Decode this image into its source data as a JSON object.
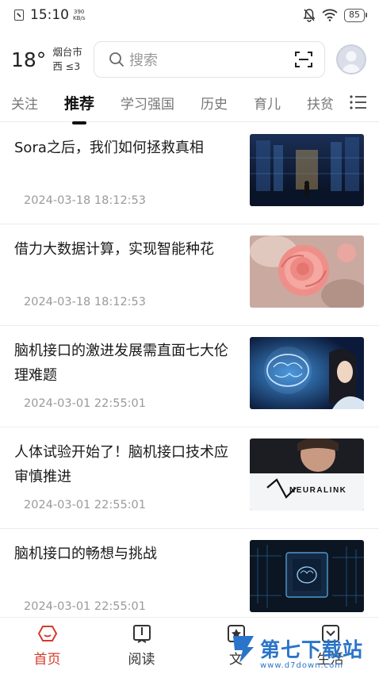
{
  "status_bar": {
    "time": "15:10",
    "speed_value": "390",
    "speed_unit": "KB/s",
    "battery": "85"
  },
  "header": {
    "temperature": "18°",
    "city": "烟台市",
    "wind": "西 ≤3",
    "search_placeholder": "搜索"
  },
  "tabs": [
    "关注",
    "推荐",
    "学习强国",
    "历史",
    "育儿",
    "扶贫"
  ],
  "active_tab": "推荐",
  "articles": [
    {
      "title": "Sora之后，我们如何拯救真相",
      "date": "2024-03-18 18:12:53",
      "image": "futuristic-corridor"
    },
    {
      "title": "借力大数据计算，实现智能种花",
      "date": "2024-03-18 18:12:53",
      "image": "pink-rose"
    },
    {
      "title": "脑机接口的激进发展需直面七大伦理难题",
      "date": "2024-03-01 22:55:01",
      "image": "brain-hologram"
    },
    {
      "title": "人体试验开始了！脑机接口技术应审慎推进",
      "date": "2024-03-01 22:55:01",
      "image": "neuralink"
    },
    {
      "title": "脑机接口的畅想与挑战",
      "date": "2024-03-01 22:55:01",
      "image": "brain-chip"
    }
  ],
  "neuralink_text": "NEURALINK",
  "bottom_nav": [
    {
      "label": "首页",
      "icon": "home-icon",
      "active": true
    },
    {
      "label": "阅读",
      "icon": "book-icon",
      "active": false
    },
    {
      "label": "文",
      "icon": "star-icon",
      "active": false
    },
    {
      "label": "生活",
      "icon": "life-icon",
      "active": false
    }
  ],
  "watermark": {
    "text": "第七下载站",
    "sub": "www.d7down.com"
  },
  "colors": {
    "accent": "#d33b2c",
    "watermark": "#2a75c9"
  }
}
